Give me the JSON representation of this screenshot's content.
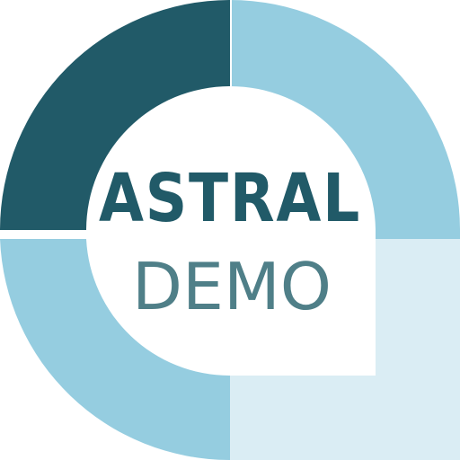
{
  "logo": {
    "wordmark": "ASTRAL",
    "subtitle": "DEMO"
  },
  "colors": {
    "dark_teal": "#215a68",
    "light_blue": "#95cde0",
    "pale_blue": "#daedf4",
    "demo_text": "#4f7f88",
    "background": "#ffffff"
  }
}
